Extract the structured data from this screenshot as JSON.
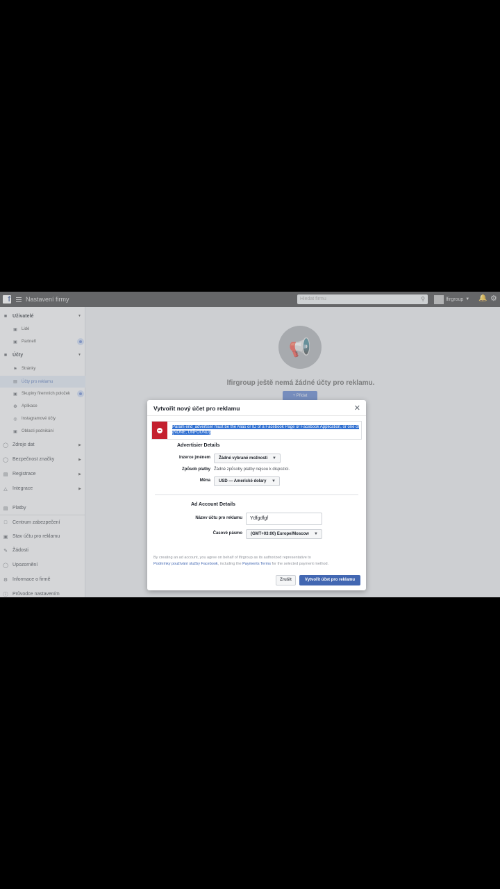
{
  "topbar": {
    "app_title": "Nastavení firmy",
    "search_placeholder": "Hledat firmu",
    "account_name": "lfirgroup"
  },
  "sidebar": {
    "sections": [
      {
        "label": "Uživatelé",
        "icon": "users-icon"
      },
      {
        "label": "Účty",
        "icon": "accounts-icon"
      }
    ],
    "users_items": [
      {
        "label": "Lidé",
        "icon": "people-icon"
      },
      {
        "label": "Partneři",
        "icon": "partners-icon"
      }
    ],
    "accounts_items": [
      {
        "label": "Stránky",
        "icon": "flag-icon"
      },
      {
        "label": "Účty pro reklamu",
        "icon": "ad-account-icon",
        "active": true
      },
      {
        "label": "Skupiny firemních položek",
        "icon": "asset-groups-icon"
      },
      {
        "label": "Aplikace",
        "icon": "apps-icon"
      },
      {
        "label": "Instagramové účty",
        "icon": "instagram-icon"
      },
      {
        "label": "Oblasti podnikání",
        "icon": "business-areas-icon"
      }
    ],
    "collapsible": [
      {
        "label": "Zdroje dat",
        "icon": "data-sources-icon"
      },
      {
        "label": "Bezpečnost značky",
        "icon": "brand-safety-icon"
      },
      {
        "label": "Registrace",
        "icon": "registration-icon"
      },
      {
        "label": "Integrace",
        "icon": "integrations-icon"
      }
    ],
    "bottom_items": [
      {
        "label": "Platby",
        "icon": "payments-icon"
      },
      {
        "label": "Centrum zabezpečení",
        "icon": "security-center-icon"
      },
      {
        "label": "Stav účtu pro reklamu",
        "icon": "account-status-icon"
      },
      {
        "label": "Žádosti",
        "icon": "requests-icon"
      },
      {
        "label": "Upozornění",
        "icon": "notifications-icon"
      },
      {
        "label": "Informace o firmě",
        "icon": "business-info-icon"
      },
      {
        "label": "Průvodce nastavením",
        "icon": "setup-guide-icon"
      }
    ]
  },
  "main": {
    "empty_text": "lfirgroup ještě nemá žádné účty pro reklamu.",
    "add_button": "+ Přidat"
  },
  "dialog": {
    "title": "Vytvořit nový účet pro reklamu",
    "error_message": "Param end_advertiser must be the Alias or ID of a Facebook Page or Facebook Application, or one of {NONE, UNFOUND}",
    "advertiser_section": "Advertisier Details",
    "advertise_as_label": "Inzerce jménem",
    "advertise_as_value": "Žádné vybrané možnosti",
    "payment_label": "Způsob platby",
    "payment_value": "Žádné způsoby platby nejsou k dispozici.",
    "currency_label": "Měna",
    "currency_value": "USD — Americké dolary",
    "ad_account_section": "Ad Account Details",
    "account_name_label": "Název účtu pro reklamu",
    "account_name_value": "Ydfgdfgf",
    "timezone_label": "Časové pásmo",
    "timezone_value": "(GMT+03:00) Europe/Moscow",
    "legal_prefix": "By creating an ad account, you agree on behalf of lfirgroup as its authorized representative to",
    "legal_link1": "Podmínky používání služby Facebook",
    "legal_mid": ", including the",
    "legal_link2": "Payments Terms",
    "legal_suffix": "for the selected payment method.",
    "cancel_button": "Zrušit",
    "create_button": "Vytvořit účet pro reklamu"
  },
  "colors": {
    "brand": "#4267b2",
    "error": "#c4202f",
    "topbar": "#2c2c2e"
  }
}
